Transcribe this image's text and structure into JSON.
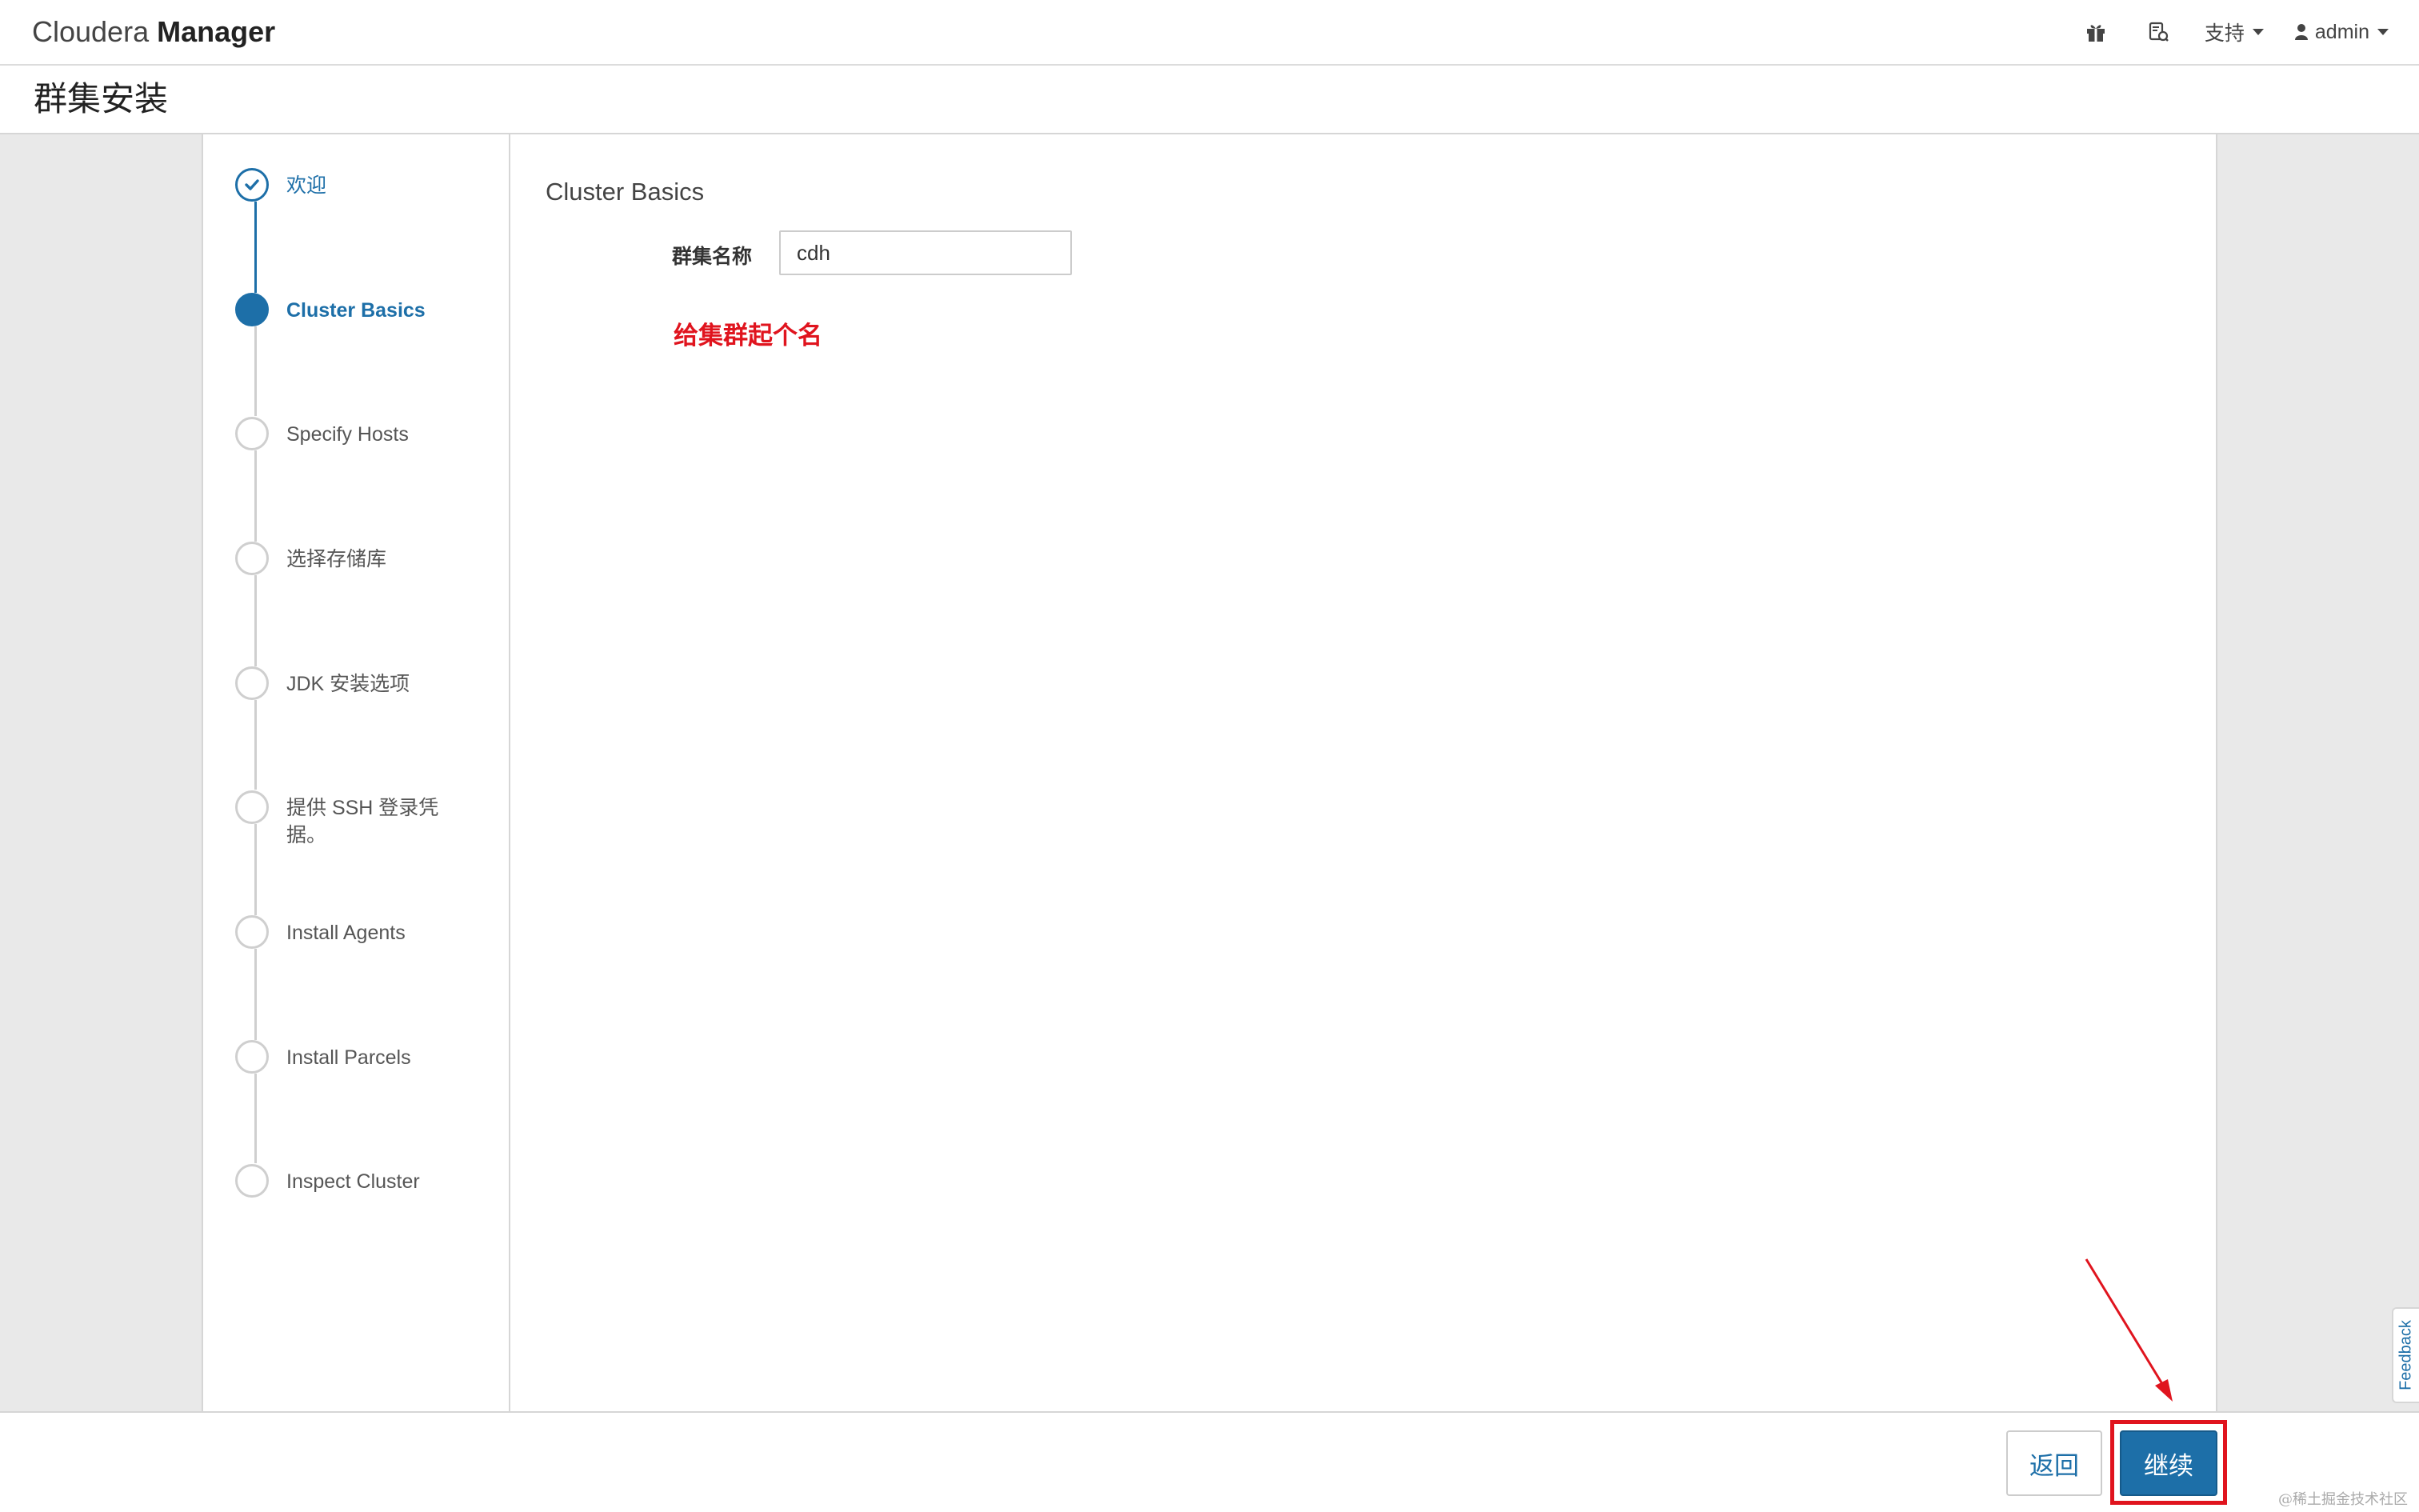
{
  "navbar": {
    "brand_light": "Cloudera",
    "brand_bold": "Manager",
    "icons": [
      "gift-icon",
      "support-ticket-icon"
    ],
    "support_label": "支持",
    "user_label": "admin"
  },
  "page": {
    "title": "群集安装"
  },
  "steps": [
    {
      "label": "欢迎",
      "state": "done"
    },
    {
      "label": "Cluster Basics",
      "state": "active"
    },
    {
      "label": "Specify Hosts",
      "state": "pending"
    },
    {
      "label": "选择存储库",
      "state": "pending"
    },
    {
      "label": "JDK 安装选项",
      "state": "pending"
    },
    {
      "label": "提供 SSH 登录凭据。",
      "state": "pending"
    },
    {
      "label": "Install Agents",
      "state": "pending"
    },
    {
      "label": "Install Parcels",
      "state": "pending"
    },
    {
      "label": "Inspect Cluster",
      "state": "pending"
    }
  ],
  "main": {
    "section_title": "Cluster Basics",
    "cluster_name_label": "群集名称",
    "cluster_name_value": "cdh",
    "annotation": "给集群起个名"
  },
  "footer": {
    "back_label": "返回",
    "continue_label": "继续"
  },
  "feedback_label": "Feedback",
  "watermark": "@稀土掘金技术社区",
  "colors": {
    "accent": "#1d6fa8",
    "annotation_red": "#e0141e"
  }
}
